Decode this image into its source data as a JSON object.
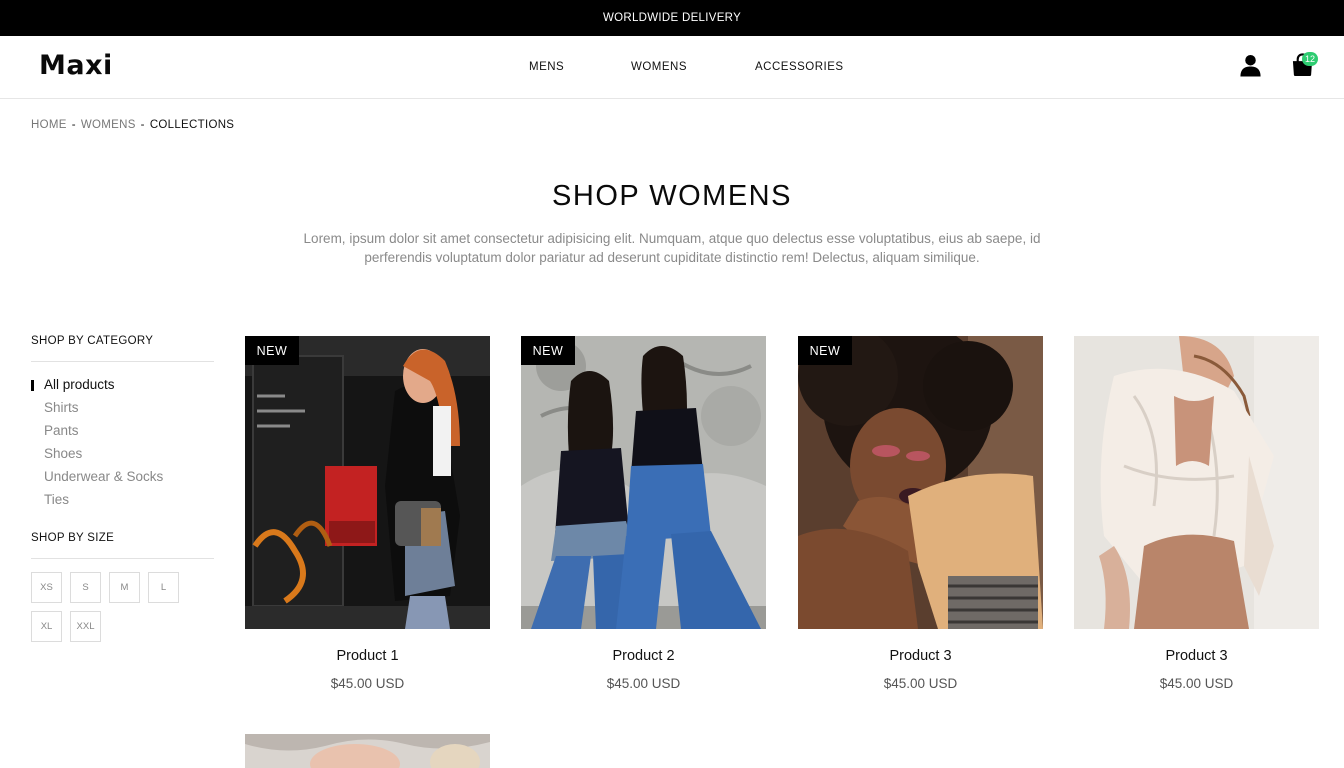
{
  "announcement": "WORLDWIDE DELIVERY",
  "header": {
    "logo": "Maxi",
    "nav": [
      "MENS",
      "WOMENS",
      "ACCESSORIES"
    ],
    "cart_count": "12",
    "icons": [
      "user-icon",
      "shopping-bag-icon"
    ]
  },
  "breadcrumb": {
    "items": [
      "HOME",
      "WOMENS"
    ],
    "separator": "-",
    "current": "COLLECTIONS"
  },
  "page": {
    "title": "SHOP WOMENS",
    "description": "Lorem, ipsum dolor sit amet consectetur adipisicing elit. Numquam, atque quo delectus esse voluptatibus, eius ab saepe, id perferendis voluptatum dolor pariatur ad deserunt cupiditate distinctio rem! Delectus, aliquam similique."
  },
  "sidebar": {
    "category_heading": "SHOP BY CATEGORY",
    "categories": [
      "All products",
      "Shirts",
      "Pants",
      "Shoes",
      "Underwear & Socks",
      "Ties"
    ],
    "active_category": "All products",
    "size_heading": "SHOP BY SIZE",
    "sizes": [
      "XS",
      "S",
      "M",
      "L",
      "XL",
      "XXL"
    ]
  },
  "products": [
    {
      "name": "Product 1",
      "price": "$45.00 USD",
      "badge": "NEW"
    },
    {
      "name": "Product 2",
      "price": "$45.00 USD",
      "badge": "NEW"
    },
    {
      "name": "Product 3",
      "price": "$45.00 USD",
      "badge": "NEW"
    },
    {
      "name": "Product 3",
      "price": "$45.00 USD",
      "badge": ""
    }
  ],
  "colors": {
    "topbar": "#000000",
    "badge": "#000000",
    "cart_badge": "#2ecc71",
    "muted_text": "#888888"
  }
}
